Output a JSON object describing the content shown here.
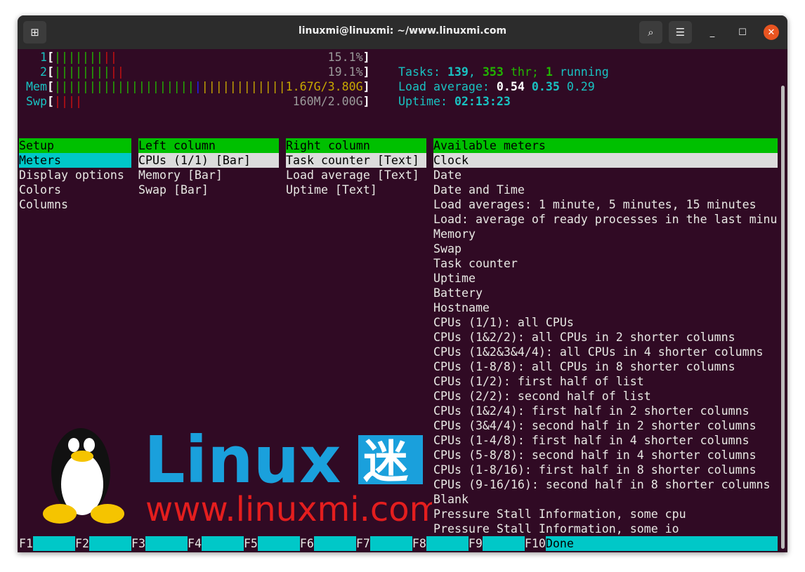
{
  "window": {
    "title": "linuxmi@linuxmi: ~/www.linuxmi.com"
  },
  "meters": {
    "cpu1": {
      "label": "1",
      "green": 7,
      "red": 2,
      "value": "15.1%"
    },
    "cpu2": {
      "label": "2",
      "green": 8,
      "red": 2,
      "value": "19.1%"
    },
    "mem": {
      "label": "Mem",
      "green": 20,
      "blue": 1,
      "yellow": 12,
      "value": "1.67G/3.80G"
    },
    "swp": {
      "label": "Swp",
      "red": 4,
      "value": "160M/2.00G"
    }
  },
  "stats": {
    "tasks_label": "Tasks: ",
    "tasks": "139",
    "sep": ", ",
    "threads": "353",
    "thr_label": " thr; ",
    "running": "1",
    "running_label": " running",
    "load_label": "Load average: ",
    "load1": "0.54",
    "load5": "0.35",
    "load15": "0.29",
    "uptime_label": "Uptime: ",
    "uptime": "02:13:23"
  },
  "setup": {
    "header": "Setup",
    "items": [
      "Meters",
      "Display options",
      "Colors",
      "Columns"
    ]
  },
  "left_column": {
    "header": "Left column",
    "items": [
      "CPUs (1/1) [Bar]",
      "Memory [Bar]",
      "Swap [Bar]"
    ]
  },
  "right_column": {
    "header": "Right column",
    "items": [
      "Task counter [Text]",
      "Load average [Text]",
      "Uptime [Text]"
    ]
  },
  "available": {
    "header": "Available meters",
    "items": [
      "Clock",
      "Date",
      "Date and Time",
      "Load averages: 1 minute, 5 minutes, 15 minutes",
      "Load: average of ready processes in the last minu",
      "Memory",
      "Swap",
      "Task counter",
      "Uptime",
      "Battery",
      "Hostname",
      "CPUs (1/1): all CPUs",
      "CPUs (1&2/2): all CPUs in 2 shorter columns",
      "CPUs (1&2&3&4/4): all CPUs in 4 shorter columns",
      "CPUs (1-8/8): all CPUs in 8 shorter columns",
      "CPUs (1/2): first half of list",
      "CPUs (2/2): second half of list",
      "CPUs (1&2/4): first half in 2 shorter columns",
      "CPUs (3&4/4): second half in 2 shorter columns",
      "CPUs (1-4/8): first half in 4 shorter columns",
      "CPUs (5-8/8): second half in 4 shorter columns",
      "CPUs (1-8/16): first half in 8 shorter columns",
      "CPUs (9-16/16): second half in 8 shorter columns",
      "Blank",
      "Pressure Stall Information, some cpu",
      "Pressure Stall Information, some io"
    ]
  },
  "footer": {
    "keys": [
      {
        "key": "F1",
        "label": ""
      },
      {
        "key": "F2",
        "label": ""
      },
      {
        "key": "F3",
        "label": ""
      },
      {
        "key": "F4",
        "label": ""
      },
      {
        "key": "F5",
        "label": ""
      },
      {
        "key": "F6",
        "label": ""
      },
      {
        "key": "F7",
        "label": ""
      },
      {
        "key": "F8",
        "label": ""
      },
      {
        "key": "F9",
        "label": ""
      },
      {
        "key": "F10",
        "label": "Done"
      }
    ]
  },
  "watermark": {
    "brand": "Linux迷",
    "url": "www.linuxmi.com"
  }
}
